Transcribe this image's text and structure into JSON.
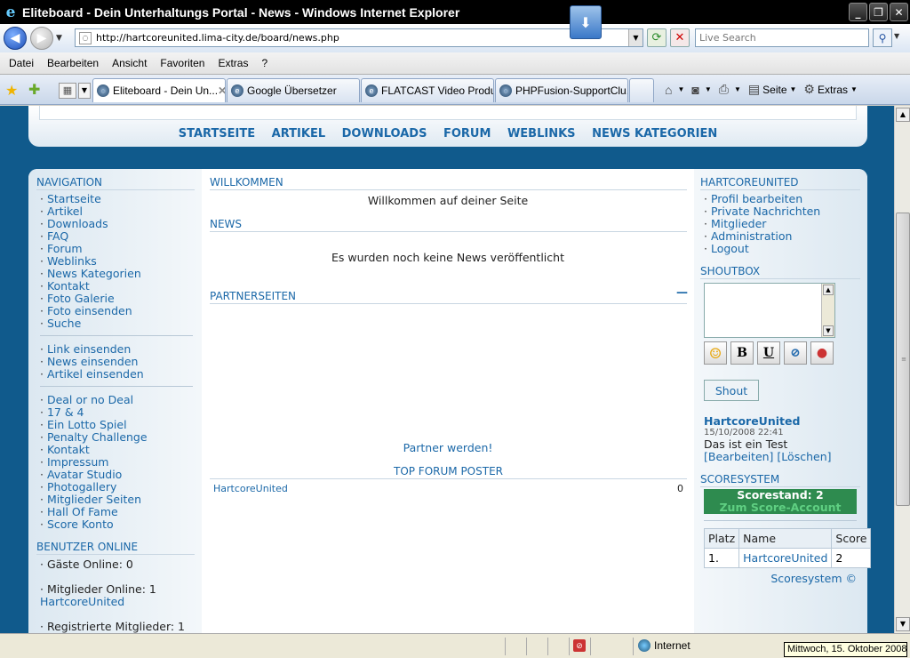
{
  "window": {
    "title": "Eliteboard - Dein Unterhaltungs Portal - News - Windows Internet Explorer",
    "min": "_",
    "max": "❐",
    "close": "✕"
  },
  "addressbar": {
    "url": "http://hartcoreunited.lima-city.de/board/news.php",
    "search_placeholder": "Live Search"
  },
  "menu": [
    "Datei",
    "Bearbeiten",
    "Ansicht",
    "Favoriten",
    "Extras",
    "?"
  ],
  "tabs": [
    {
      "label": "Eliteboard - Dein Un...",
      "active": true
    },
    {
      "label": "Google Übersetzer",
      "active": false
    },
    {
      "label": "FLATCAST Video Produ...",
      "active": false
    },
    {
      "label": "PHPFusion-SupportClu...",
      "active": false
    }
  ],
  "toolbar": {
    "page": "Seite",
    "extras": "Extras"
  },
  "topnav": [
    "STARTSEITE",
    "ARTIKEL",
    "DOWNLOADS",
    "FORUM",
    "WEBLINKS",
    "NEWS KATEGORIEN"
  ],
  "left": {
    "nav_title": "NAVIGATION",
    "nav1": [
      "Startseite",
      "Artikel",
      "Downloads",
      "FAQ",
      "Forum",
      "Weblinks",
      "News Kategorien",
      "Kontakt",
      "Foto Galerie",
      "Foto einsenden",
      "Suche"
    ],
    "nav2": [
      "Link einsenden",
      "News einsenden",
      "Artikel einsenden"
    ],
    "nav3": [
      "Deal or no Deal",
      "17 & 4",
      "Ein Lotto Spiel",
      "Penalty Challenge",
      "Kontakt",
      "Impressum",
      "Avatar Studio",
      "Photogallery",
      "Mitglieder Seiten",
      "Hall Of Fame",
      "Score Konto"
    ],
    "online_title": "BENUTZER ONLINE",
    "guests": "· Gäste Online: 0",
    "members": "· Mitglieder Online: 1",
    "member_name": "HartcoreUnited",
    "registered": "· Registrierte Mitglieder: 1"
  },
  "center": {
    "welcome_title": "WILLKOMMEN",
    "welcome_text": "Willkommen auf deiner Seite",
    "news_title": "NEWS",
    "news_text": "Es wurden noch keine News veröffentlicht",
    "partner_title": "PARTNERSEITEN",
    "partner_collapse": "—",
    "partner_link": "Partner werden!",
    "top_poster_title": "TOP FORUM POSTER",
    "top_poster_name": "HartcoreUnited",
    "top_poster_count": "0"
  },
  "right": {
    "user_title": "HARTCOREUNITED",
    "user_links": [
      "Profil bearbeiten",
      "Private Nachrichten",
      "Mitglieder",
      "Administration",
      "Logout"
    ],
    "shout_title": "SHOUTBOX",
    "shout_button": "Shout",
    "shout_author": "HartcoreUnited",
    "shout_time": "15/10/2008 22:41",
    "shout_text": "Das ist ein Test",
    "shout_edit": "[Bearbeiten]",
    "shout_delete": "[Löschen]",
    "score_title": "SCORESYSTEM",
    "score_line": "Scorestand: 2",
    "score_account": "Zum Score-Account",
    "table_headers": [
      "Platz",
      "Name",
      "Score"
    ],
    "table_row": [
      "1.",
      "HartcoreUnited",
      "2"
    ],
    "footer": "Scoresystem ©"
  },
  "status": {
    "zone": "Internet",
    "tooltip": "Mittwoch, 15. Oktober 2008"
  }
}
